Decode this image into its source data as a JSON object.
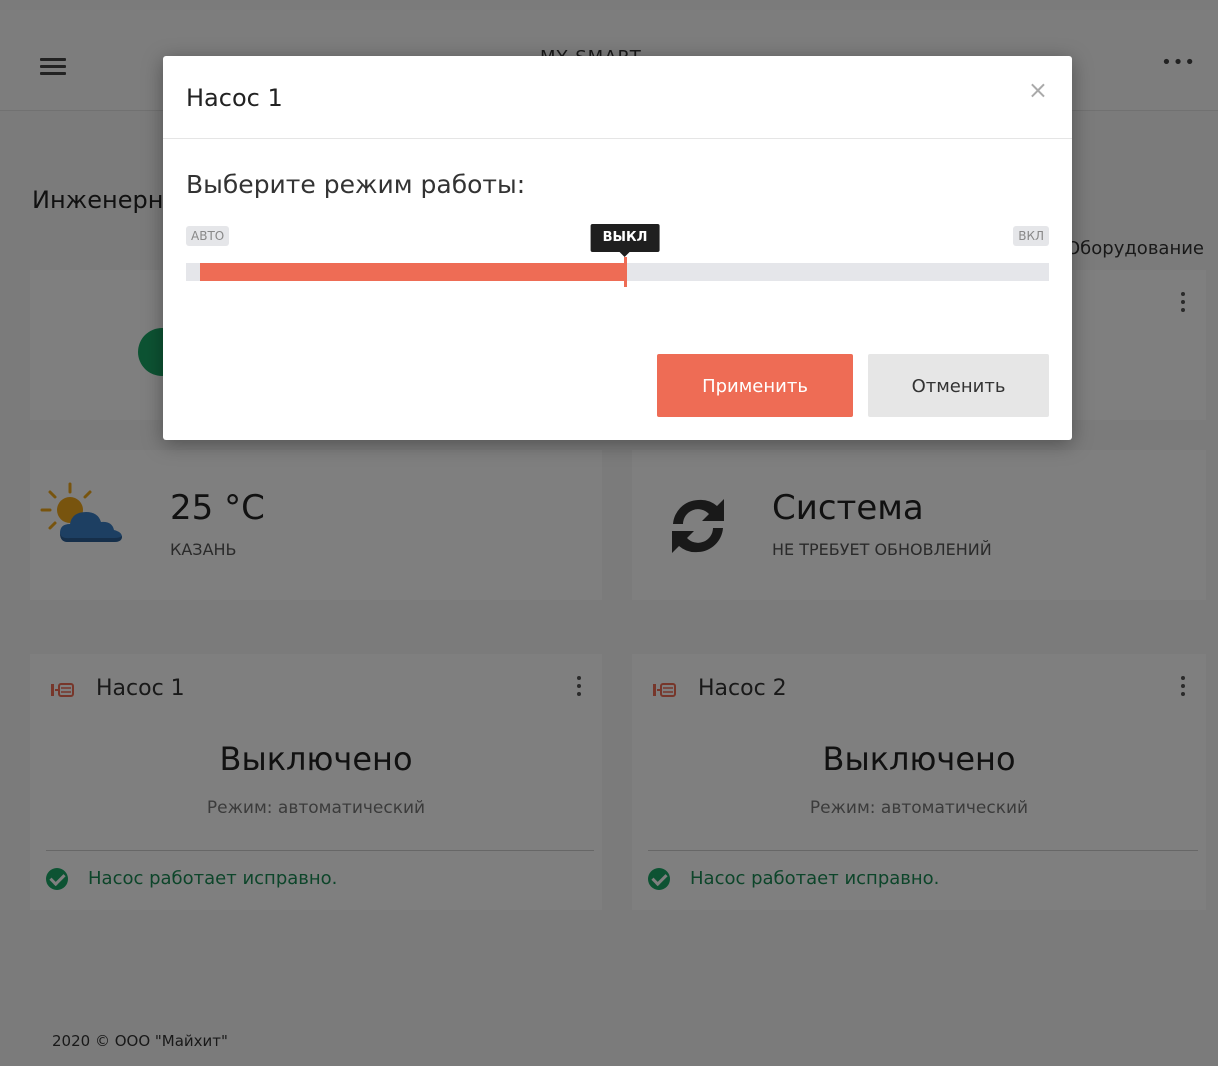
{
  "header": {
    "brand": "MY SMART"
  },
  "section": {
    "title": "Инженерные системы",
    "link": "Оборудование"
  },
  "weather": {
    "temperature": "25 °C",
    "city": "КАЗАНЬ"
  },
  "system": {
    "title": "Система",
    "status": "НЕ ТРЕБУЕТ ОБНОВЛЕНИЙ"
  },
  "pumps": [
    {
      "title": "Насос 1",
      "state": "Выключено",
      "mode": "Режим: автоматический",
      "health": "Насос работает исправно."
    },
    {
      "title": "Насос 2",
      "state": "Выключено",
      "mode": "Режим: автоматический",
      "health": "Насос работает исправно."
    }
  ],
  "footer": {
    "copyright": "2020 © ООО \"Майхит\""
  },
  "modal": {
    "title": "Насос 1",
    "close_label": "×",
    "prompt": "Выберите режим работы:",
    "slider": {
      "min_label": "АВТО",
      "max_label": "ВКЛ",
      "current_label": "ВЫКЛ",
      "value_fraction": 0.5
    },
    "apply_label": "Применить",
    "cancel_label": "Отменить"
  },
  "colors": {
    "accent": "#ee6c55",
    "success": "#1aa667",
    "overlay": "rgba(0,0,0,0.5)"
  },
  "icons": {
    "menu": "hamburger-icon",
    "more": "more-horizontal-icon",
    "weather": "partly-cloudy-icon",
    "system": "refresh-icon",
    "pump": "pump-icon",
    "ok": "check-circle-icon"
  }
}
